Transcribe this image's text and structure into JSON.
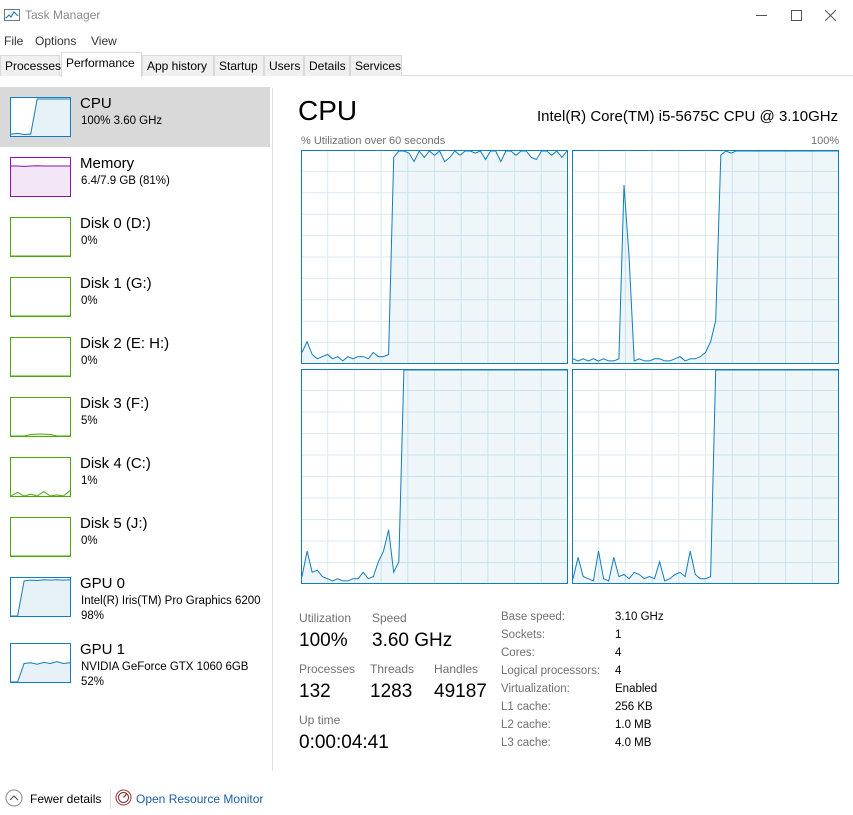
{
  "window": {
    "title": "Task Manager",
    "minimize_icon": "minimize-icon",
    "maximize_icon": "maximize-icon",
    "close_icon": "close-icon"
  },
  "menu": {
    "items": [
      "File",
      "Options",
      "View"
    ]
  },
  "tabs": [
    {
      "label": "Processes"
    },
    {
      "label": "Performance",
      "active": true
    },
    {
      "label": "App history"
    },
    {
      "label": "Startup"
    },
    {
      "label": "Users"
    },
    {
      "label": "Details"
    },
    {
      "label": "Services"
    }
  ],
  "sidebar": {
    "items": [
      {
        "name": "CPU",
        "line1": "100%  3.60 GHz",
        "line2": "",
        "color": "#117dbb",
        "active": true,
        "levels": [
          0.05,
          0.07,
          0.04,
          0.05,
          1,
          1,
          1,
          1,
          1,
          1
        ]
      },
      {
        "name": "Memory",
        "line1": "6.4/7.9 GB (81%)",
        "line2": "",
        "color": "#8b12ae",
        "levels": [
          0.81,
          0.81,
          0.8,
          0.81,
          0.82,
          0.81,
          0.81,
          0.81,
          0.81,
          0.81
        ]
      },
      {
        "name": "Disk 0 (D:)",
        "line1": "0%",
        "line2": "",
        "color": "#4da60c",
        "levels": [
          0,
          0,
          0,
          0,
          0,
          0,
          0,
          0,
          0,
          0
        ]
      },
      {
        "name": "Disk 1 (G:)",
        "line1": "0%",
        "line2": "",
        "color": "#4da60c",
        "levels": [
          0,
          0,
          0,
          0,
          0,
          0,
          0,
          0,
          0,
          0
        ]
      },
      {
        "name": "Disk 2 (E: H:)",
        "line1": "0%",
        "line2": "",
        "color": "#4da60c",
        "levels": [
          0,
          0,
          0,
          0,
          0,
          0,
          0,
          0,
          0,
          0
        ]
      },
      {
        "name": "Disk 3 (F:)",
        "line1": "5%",
        "line2": "",
        "color": "#4da60c",
        "levels": [
          0,
          0,
          0,
          0.04,
          0.05,
          0.05,
          0.04,
          0,
          0,
          0
        ]
      },
      {
        "name": "Disk 4 (C:)",
        "line1": "1%",
        "line2": "",
        "color": "#4da60c",
        "levels": [
          0,
          0.1,
          0,
          0.05,
          0,
          0.12,
          0,
          0.03,
          0,
          0.15
        ]
      },
      {
        "name": "Disk 5 (J:)",
        "line1": "0%",
        "line2": "",
        "color": "#4da60c",
        "levels": [
          0,
          0,
          0,
          0,
          0,
          0,
          0,
          0,
          0,
          0
        ]
      },
      {
        "name": "GPU 0",
        "line1": "Intel(R) Iris(TM) Pro Graphics 6200",
        "line2": "98%",
        "color": "#117dbb",
        "levels": [
          0,
          0,
          0.95,
          0.97,
          0.96,
          0.98,
          0.97,
          0.98,
          0.97,
          0.98
        ]
      },
      {
        "name": "GPU 1",
        "line1": "NVIDIA GeForce GTX 1060 6GB",
        "line2": "52%",
        "color": "#117dbb",
        "levels": [
          0,
          0,
          0.5,
          0.52,
          0.48,
          0.53,
          0.5,
          0.55,
          0.5,
          0.52
        ]
      }
    ]
  },
  "main": {
    "title": "CPU",
    "cpu_model": "Intel(R) Core(TM) i5-5675C CPU @ 3.10GHz",
    "graph_label": "% Utilization over 60 seconds",
    "graph_max": "100%",
    "cores": [
      {
        "values": [
          5,
          10,
          4,
          2,
          3,
          4,
          2,
          3,
          1,
          3,
          2,
          3,
          3,
          2,
          5,
          3,
          3,
          4,
          97,
          100,
          100,
          99,
          95,
          100,
          97,
          100,
          98,
          100,
          95,
          97,
          100,
          98,
          100,
          100,
          99,
          100,
          96,
          100,
          100,
          95,
          100,
          100,
          98,
          100,
          100,
          97,
          96,
          100,
          100,
          98,
          100,
          97,
          100
        ]
      },
      {
        "values": [
          2,
          1,
          2,
          1,
          2,
          1,
          2,
          1,
          1,
          2,
          84,
          50,
          1,
          2,
          1,
          1,
          2,
          2,
          1,
          1,
          2,
          3,
          1,
          2,
          2,
          3,
          5,
          10,
          20,
          98,
          100,
          99,
          100,
          100,
          100,
          100,
          100,
          100,
          100,
          100,
          100,
          100,
          100,
          100,
          100,
          100,
          100,
          100,
          100,
          100,
          100,
          100,
          100
        ]
      },
      {
        "values": [
          3,
          15,
          5,
          6,
          3,
          2,
          1,
          2,
          1,
          1,
          2,
          2,
          5,
          2,
          3,
          10,
          15,
          25,
          5,
          10,
          100,
          100,
          100,
          100,
          100,
          100,
          100,
          100,
          100,
          100,
          100,
          100,
          100,
          100,
          100,
          100,
          100,
          100,
          100,
          100,
          100,
          100,
          100,
          100,
          100,
          100,
          100,
          100,
          100,
          100,
          100,
          100,
          100
        ]
      },
      {
        "values": [
          2,
          12,
          3,
          2,
          1,
          15,
          2,
          1,
          12,
          3,
          4,
          2,
          5,
          4,
          2,
          3,
          2,
          10,
          1,
          2,
          4,
          5,
          3,
          15,
          4,
          2,
          2,
          3,
          100,
          100,
          100,
          100,
          100,
          100,
          100,
          100,
          100,
          100,
          100,
          100,
          100,
          100,
          100,
          100,
          100,
          100,
          100,
          100,
          100,
          100,
          100,
          100,
          100
        ]
      }
    ],
    "stats": {
      "utilization_label": "Utilization",
      "utilization": "100%",
      "speed_label": "Speed",
      "speed": "3.60 GHz",
      "processes_label": "Processes",
      "processes": "132",
      "threads_label": "Threads",
      "threads": "1283",
      "handles_label": "Handles",
      "handles": "49187",
      "uptime_label": "Up time",
      "uptime": "0:00:04:41"
    },
    "specs": [
      {
        "label": "Base speed:",
        "value": "3.10 GHz"
      },
      {
        "label": "Sockets:",
        "value": "1"
      },
      {
        "label": "Cores:",
        "value": "4"
      },
      {
        "label": "Logical processors:",
        "value": "4"
      },
      {
        "label": "Virtualization:",
        "value": "Enabled"
      },
      {
        "label": "L1 cache:",
        "value": "256 KB"
      },
      {
        "label": "L2 cache:",
        "value": "1.0 MB"
      },
      {
        "label": "L3 cache:",
        "value": "4.0 MB"
      }
    ]
  },
  "footer": {
    "fewer_details": "Fewer details",
    "open_resource_monitor": "Open Resource Monitor"
  },
  "colors": {
    "cpu_line": "#117dbb",
    "cpu_fill": "#f1f6fa",
    "grid": "#d9eaf4",
    "memory": "#8b12ae",
    "disk": "#4da60c",
    "link": "#1a5ea8"
  }
}
